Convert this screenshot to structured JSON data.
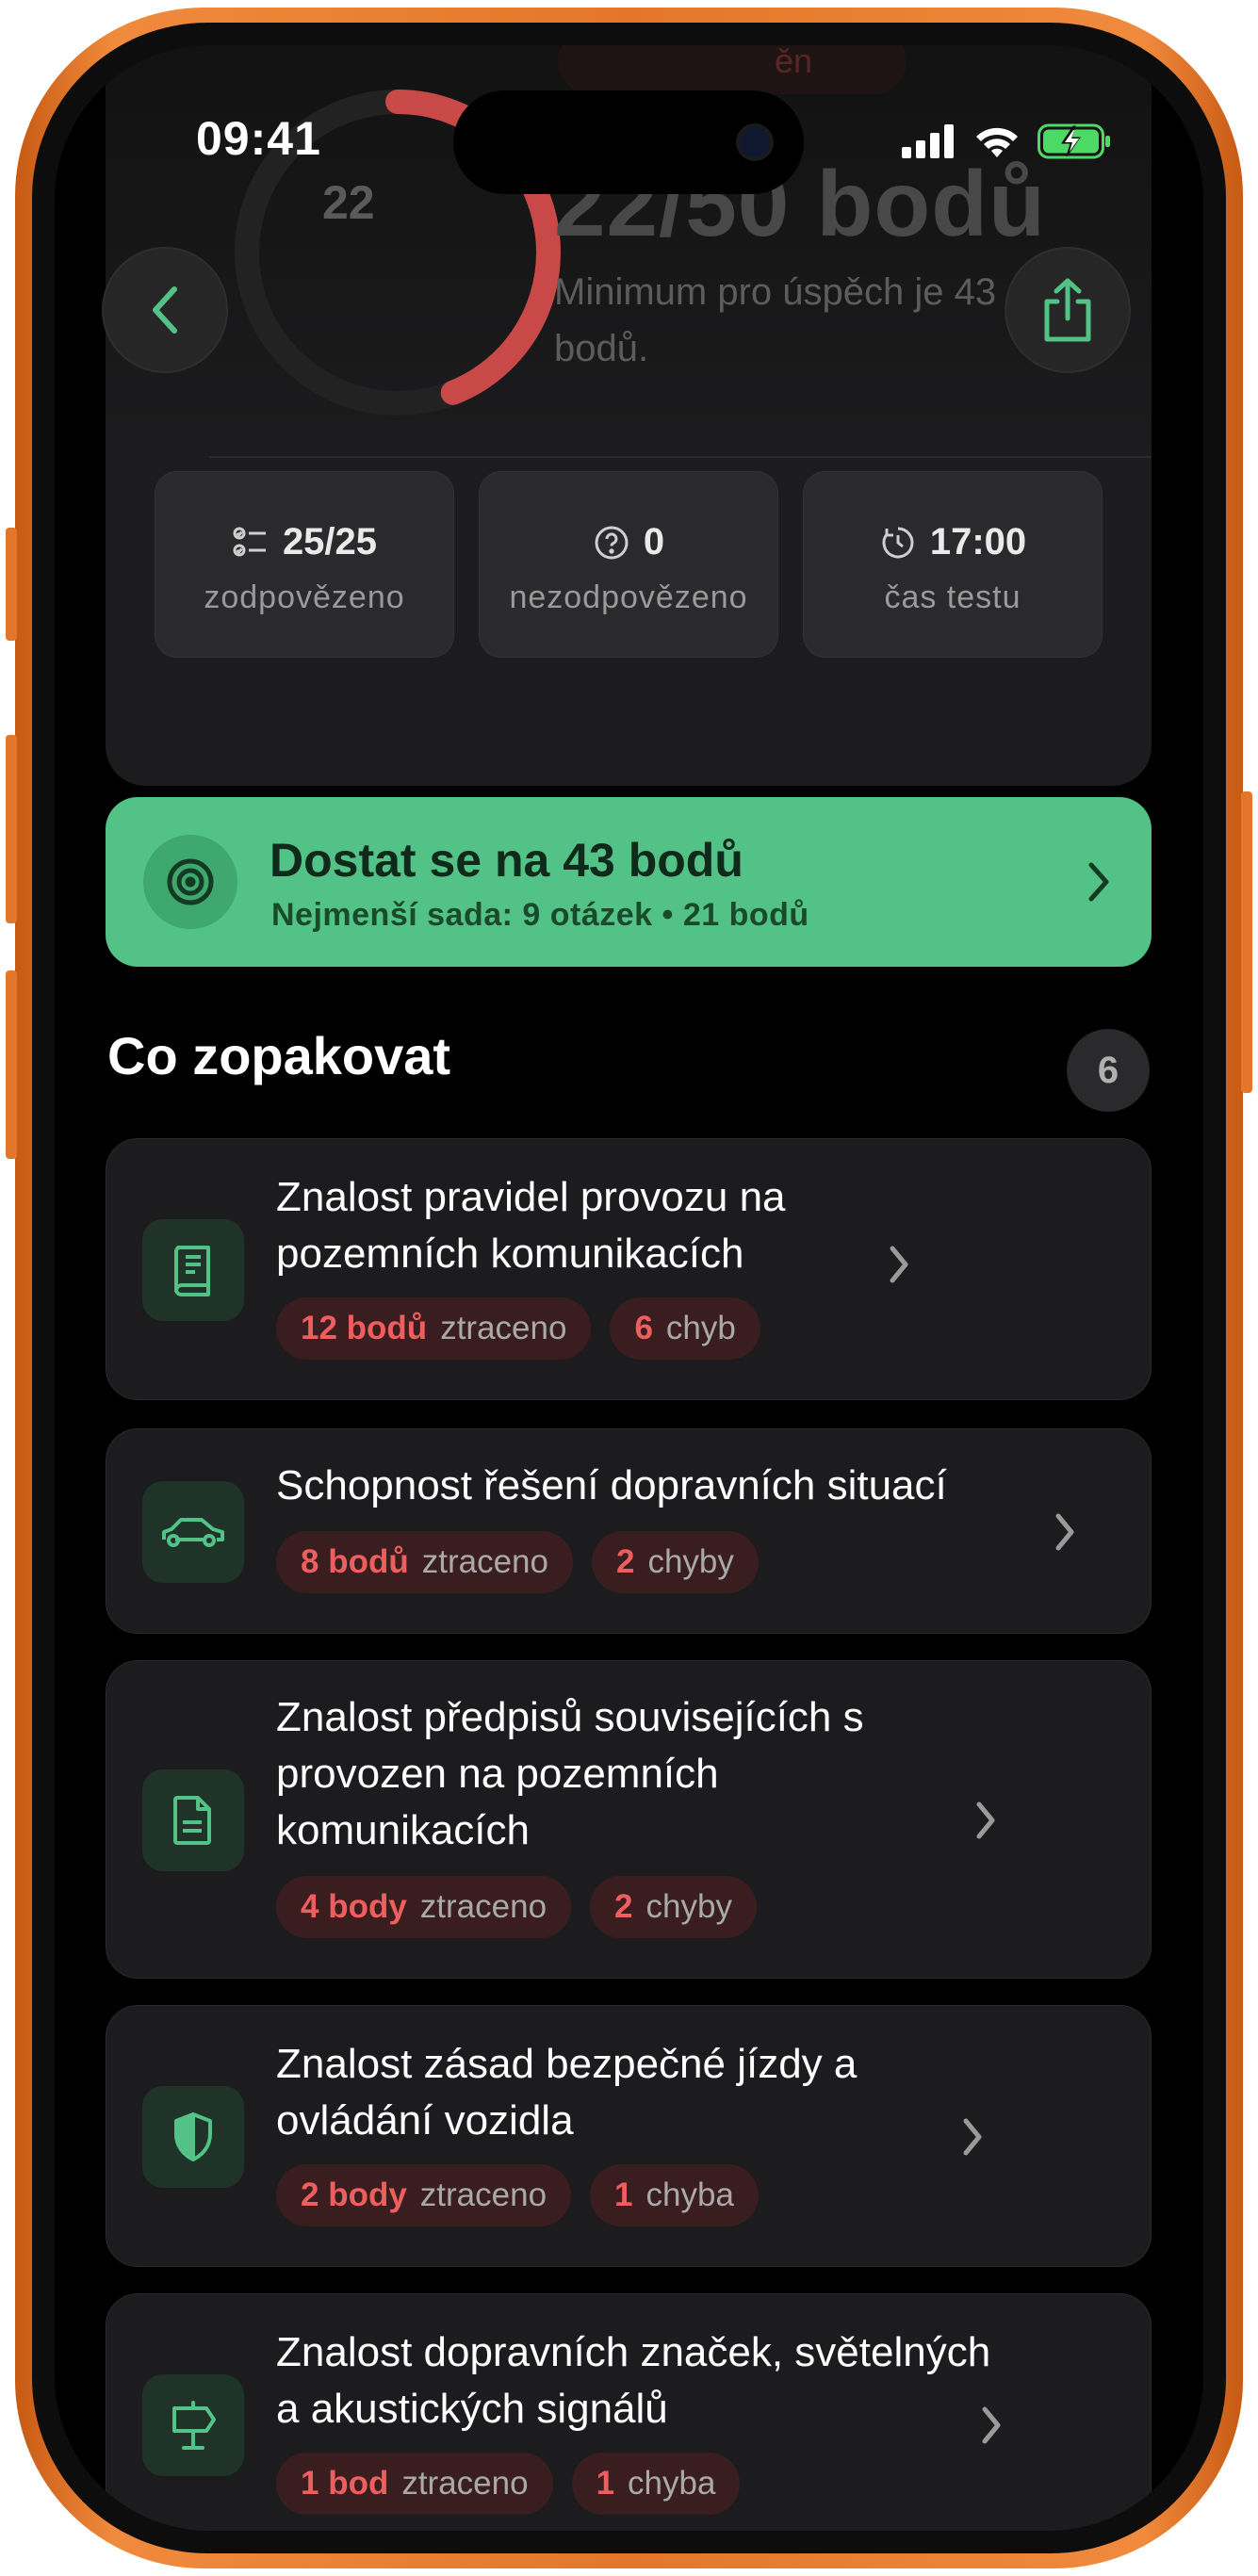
{
  "status_bar": {
    "time": "09:41"
  },
  "score": {
    "gauge_value": "22",
    "title": "22/50 bodů",
    "subtitle": "Minimum pro úspěch je 43 bodů.",
    "behind_chip_text": "ěn",
    "progress_fraction": 0.44
  },
  "stats": [
    {
      "value": "25/25",
      "label": "zodpovězeno",
      "icon": "checklist-icon"
    },
    {
      "value": "0",
      "label": "nezodpovězeno",
      "icon": "question-circle-icon"
    },
    {
      "value": "17:00",
      "label": "čas testu",
      "icon": "timer-icon"
    }
  ],
  "goal": {
    "title": "Dostat se na 43 bodů",
    "subtitle": "Nejmenší sada: 9 otázek • 21 bodů",
    "icon": "target-icon"
  },
  "review": {
    "title": "Co zopakovat",
    "count": "6",
    "topics": [
      {
        "title": "Znalost pravidel provozu na pozemních komunikacích",
        "points": "12 bodů",
        "points_suffix": "ztraceno",
        "errors_num": "6",
        "errors_word": "chyb",
        "icon": "book-icon"
      },
      {
        "title": "Schopnost řešení dopravních situací",
        "points": "8 bodů",
        "points_suffix": "ztraceno",
        "errors_num": "2",
        "errors_word": "chyby",
        "icon": "car-icon"
      },
      {
        "title": "Znalost předpisů souvisejících s provozen na pozemních komunikacích",
        "points": "4 body",
        "points_suffix": "ztraceno",
        "errors_num": "2",
        "errors_word": "chyby",
        "icon": "document-icon"
      },
      {
        "title": "Znalost zásad bezpečné jízdy a ovládání vozidla",
        "points": "2 body",
        "points_suffix": "ztraceno",
        "errors_num": "1",
        "errors_word": "chyba",
        "icon": "shield-icon"
      },
      {
        "title": "Znalost dopravních značek, světelných a akustických signálů",
        "points": "1 bod",
        "points_suffix": "ztraceno",
        "errors_num": "1",
        "errors_word": "chyba",
        "icon": "signpost-icon"
      }
    ]
  },
  "colors": {
    "accent_green": "#52c287",
    "error_red": "#ef5e5f",
    "frame_orange": "#e3762a"
  }
}
